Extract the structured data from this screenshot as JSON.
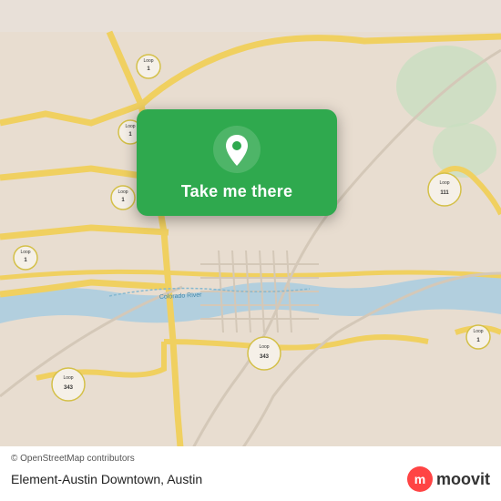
{
  "map": {
    "background_color": "#e8ddd0",
    "attribution": "© OpenStreetMap contributors"
  },
  "popup": {
    "label": "Take me there",
    "bg_color": "#2fa94e",
    "pin_color": "#ffffff"
  },
  "bottom_bar": {
    "copyright": "© OpenStreetMap contributors",
    "location_name": "Element-Austin Downtown, Austin"
  },
  "moovit": {
    "text": "moovit"
  }
}
